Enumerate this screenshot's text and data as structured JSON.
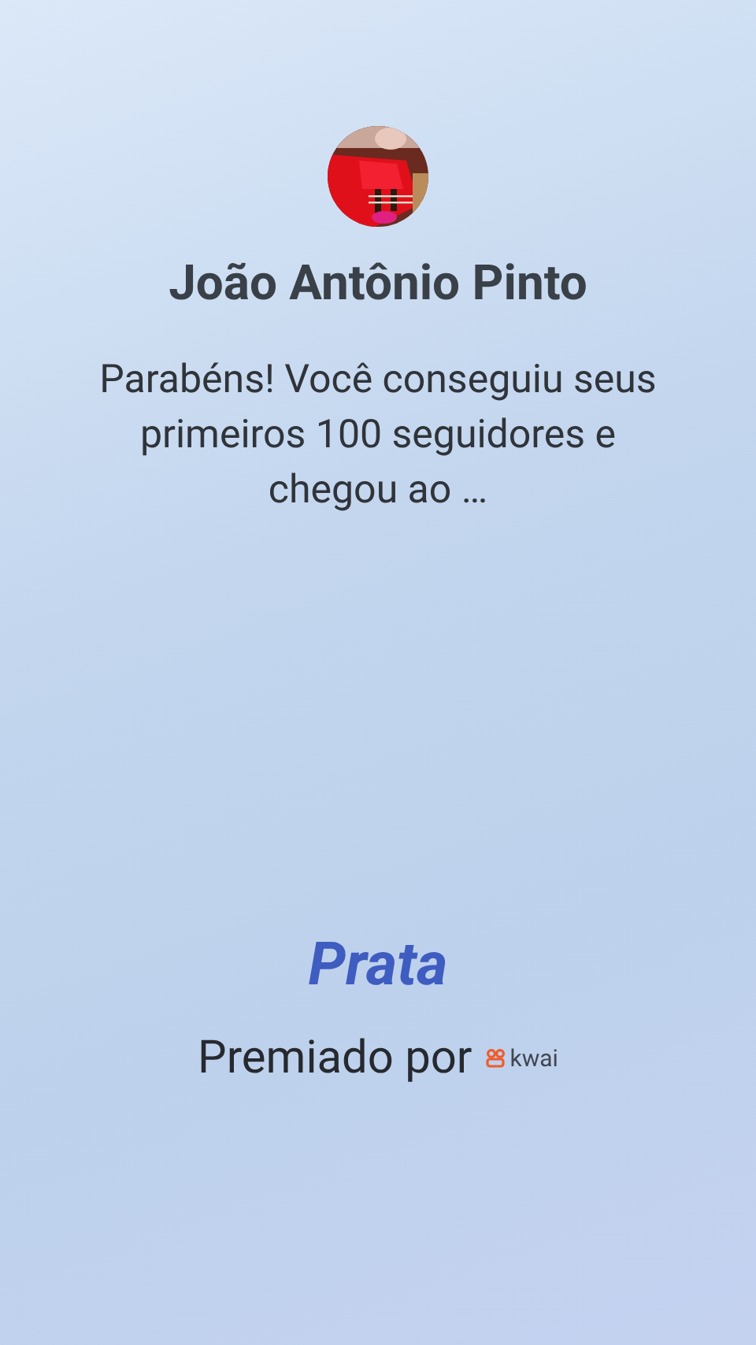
{
  "profile": {
    "name": "João Antônio Pinto"
  },
  "message": "Parabéns! Você conseguiu seus primeiros 100 seguidores e chegou ao …",
  "badge": {
    "level_name": "Prata"
  },
  "award": {
    "label": "Premiado por",
    "brand": "kwai"
  }
}
